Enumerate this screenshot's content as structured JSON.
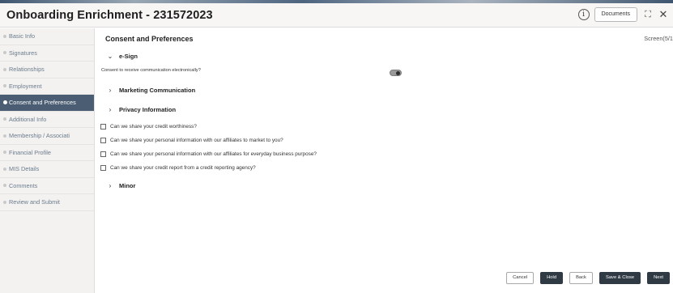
{
  "header": {
    "title": "Onboarding Enrichment - 231572023",
    "documents_label": "Documents",
    "info_icon": "i",
    "expand_icon": "⛶",
    "close_icon": "✕"
  },
  "sidebar": {
    "items": [
      {
        "label": "Basic Info"
      },
      {
        "label": "Signatures"
      },
      {
        "label": "Relationships"
      },
      {
        "label": "Employment"
      },
      {
        "label": "Consent and Preferences",
        "active": true
      },
      {
        "label": "Additional Info"
      },
      {
        "label": "Membership / Associati"
      },
      {
        "label": "Financial Profile"
      },
      {
        "label": "MIS Details"
      },
      {
        "label": "Comments"
      },
      {
        "label": "Review and Submit"
      }
    ]
  },
  "main": {
    "section_title": "Consent and Preferences",
    "screen_indicator": "Screen(5/1",
    "esign": {
      "label": "e-Sign",
      "consent_text": "Consent to receive communication electronically?",
      "toggle_on": true
    },
    "marketing_label": "Marketing Communication",
    "privacy_label": "Privacy Information",
    "questions": [
      "Can we share your credit worthiness?",
      "Can we share your personal information with our affiliates to market to you?",
      "Can we share your personal information with our affiliates for everyday business purpose?",
      "Can we share your credit report from a credit reporting agency?"
    ],
    "minor_label": "Minor"
  },
  "footer": {
    "cancel": "Cancel",
    "hold": "Hold",
    "back": "Back",
    "save_close": "Save & Close",
    "next": "Next"
  },
  "colors": {
    "sidebar_active": "#4b5d72",
    "dark_button": "#2f3a45",
    "sidebar_text": "#6b7c8e"
  }
}
